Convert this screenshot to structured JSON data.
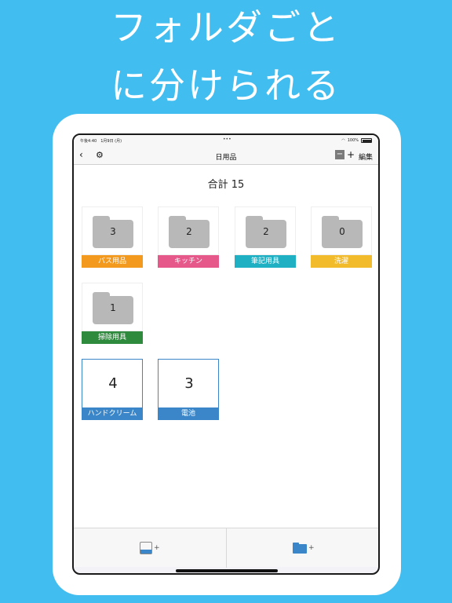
{
  "headline": {
    "line1": "フォルダごと",
    "line2": "に分けられる"
  },
  "status_bar": {
    "time_date": "午後4:40　1月9日 (月)",
    "battery": "100%"
  },
  "nav": {
    "title": "日用品",
    "edit_label": "編集",
    "minus": "−",
    "plus": "+"
  },
  "total_label": "合計 15",
  "folders": [
    {
      "name": "バス用品",
      "count": "3",
      "color": "#f39a1e"
    },
    {
      "name": "キッチン",
      "count": "2",
      "color": "#e6578a"
    },
    {
      "name": "筆記用具",
      "count": "2",
      "color": "#1fb0c4"
    },
    {
      "name": "洗濯",
      "count": "0",
      "color": "#f2bb2c"
    },
    {
      "name": "掃除用具",
      "count": "1",
      "color": "#2e8b3d"
    }
  ],
  "items": [
    {
      "name": "ハンドクリーム",
      "count": "4",
      "color": "#3a86c8"
    },
    {
      "name": "電池",
      "count": "3",
      "color": "#3a86c8"
    }
  ],
  "toolbar": {
    "add_item_plus": "+",
    "add_folder_plus": "+"
  },
  "colors": {
    "background": "#42bdf0",
    "accent": "#3a86c8",
    "folder_gray": "#b8b8b8"
  }
}
